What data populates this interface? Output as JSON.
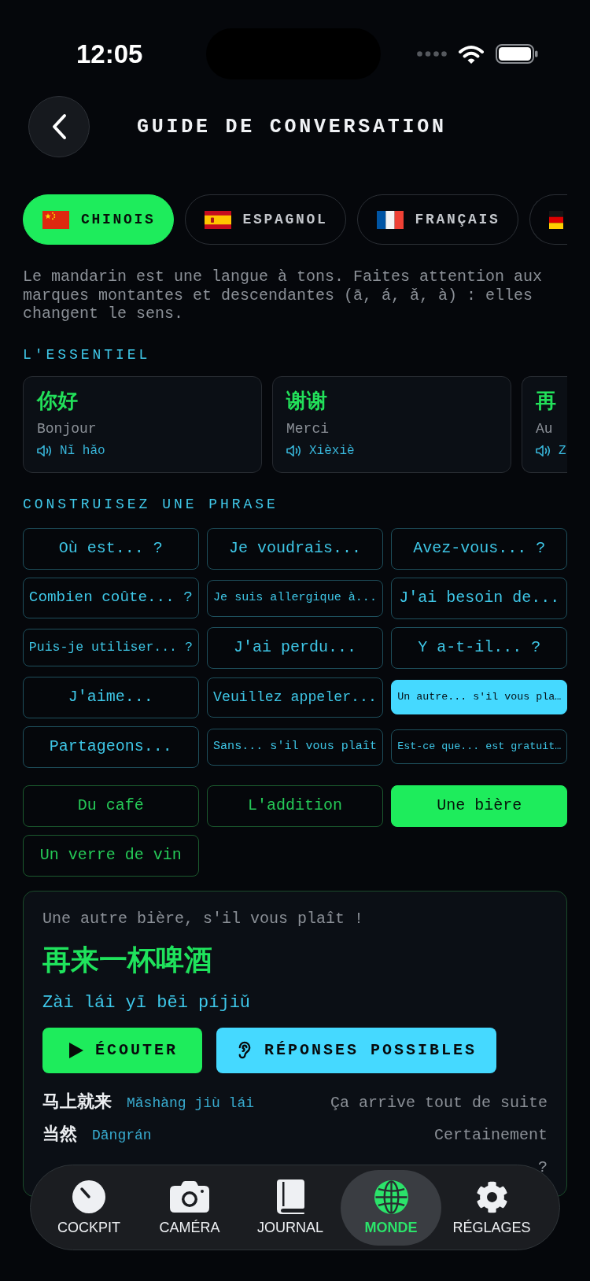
{
  "status_bar": {
    "time": "12:05"
  },
  "header": {
    "title": "GUIDE DE CONVERSATION"
  },
  "language_tabs": [
    {
      "kind": "china",
      "label": "CHINOIS",
      "selected": true
    },
    {
      "kind": "spain",
      "label": "ESPAGNOL",
      "selected": false
    },
    {
      "kind": "france",
      "label": "FRANÇAIS",
      "selected": false
    },
    {
      "kind": "germany",
      "selected": false
    }
  ],
  "description": "Le mandarin est une langue à tons. Faites attention aux marques montantes et descendantes (ā, á, ǎ, à) : elles changent le sens.",
  "essentials": {
    "heading": "L'ESSENTIEL",
    "cards": [
      {
        "hanzi": "你好",
        "meaning": "Bonjour",
        "pinyin": "Nǐ hǎo"
      },
      {
        "hanzi": "谢谢",
        "meaning": "Merci",
        "pinyin": "Xièxiè"
      },
      {
        "hanzi": "再",
        "meaning": "Au",
        "pinyin": "Z"
      }
    ]
  },
  "sentence_builder": {
    "heading": "CONSTRUISEZ UNE PHRASE",
    "patterns": [
      {
        "label": "Où est... ?",
        "selected": false
      },
      {
        "label": "Je voudrais...",
        "selected": false
      },
      {
        "label": "Avez-vous... ?",
        "selected": false
      },
      {
        "label": "Combien coûte... ?",
        "selected": false
      },
      {
        "label": "Je suis allergique à...",
        "selected": false
      },
      {
        "label": "J'ai besoin de...",
        "selected": false
      },
      {
        "label": "Puis-je utiliser... ?",
        "selected": false
      },
      {
        "label": "J'ai perdu...",
        "selected": false
      },
      {
        "label": "Y a-t-il... ?",
        "selected": false
      },
      {
        "label": "J'aime...",
        "selected": false
      },
      {
        "label": "Veuillez appeler...",
        "selected": false
      },
      {
        "label": "Un autre... s'il vous pla…",
        "selected": true
      },
      {
        "label": "Partageons...",
        "selected": false
      },
      {
        "label": "Sans... s'il vous plaît",
        "selected": false
      },
      {
        "label": "Est-ce que... est gratuit…",
        "selected": false
      }
    ],
    "objects": [
      {
        "label": "Du café",
        "selected": false
      },
      {
        "label": "L'addition",
        "selected": false
      },
      {
        "label": "Une bière",
        "selected": true
      },
      {
        "label": "Un verre de vin",
        "selected": false
      }
    ]
  },
  "result": {
    "french": "Une autre bière, s'il vous plaît !",
    "hanzi": "再来一杯啤酒",
    "pinyin": "Zài lái yī bēi píjiǔ",
    "buttons": [
      {
        "kind": "play",
        "label": "ÉCOUTER"
      },
      {
        "kind": "responses",
        "label": "RÉPONSES POSSIBLES"
      }
    ],
    "responses": [
      {
        "hanzi": "马上就来",
        "pinyin": "Mǎshàng jiù lái",
        "french": "Ça arrive tout de suite"
      },
      {
        "hanzi": "当然",
        "pinyin": "Dāngrán",
        "french": "Certainement"
      },
      {
        "french": "?"
      }
    ]
  },
  "tab_bar": [
    {
      "kind": "gauge",
      "label": "COCKPIT",
      "selected": false
    },
    {
      "kind": "camera",
      "label": "CAMÉRA",
      "selected": false
    },
    {
      "kind": "book",
      "label": "JOURNAL",
      "selected": false
    },
    {
      "kind": "globe",
      "label": "MONDE",
      "selected": true
    },
    {
      "kind": "gear",
      "label": "RÉGLAGES",
      "selected": false
    }
  ]
}
